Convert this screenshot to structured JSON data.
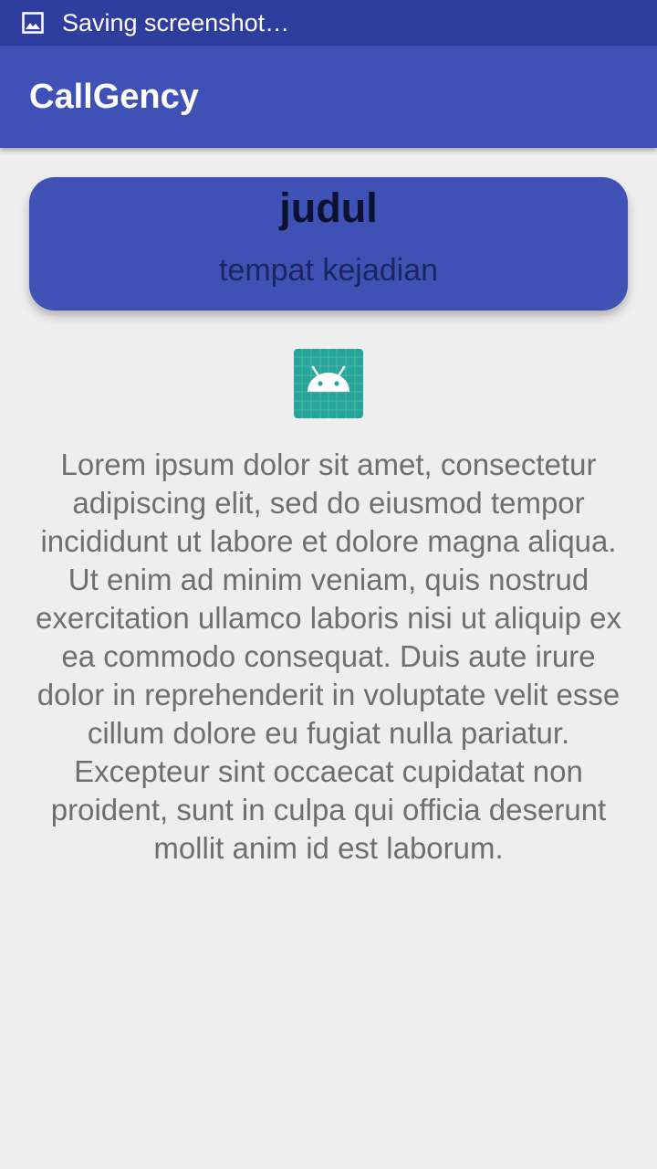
{
  "status_bar": {
    "notification_text": "Saving screenshot…",
    "icon": "image-icon"
  },
  "app_bar": {
    "title": "CallGency"
  },
  "card": {
    "title": "judul",
    "subtitle": "tempat kejadian"
  },
  "image": {
    "icon": "android-placeholder-icon"
  },
  "content": {
    "description": "Lorem ipsum dolor sit amet, consectetur adipiscing elit, sed do eiusmod tempor incididunt ut labore et dolore magna aliqua. Ut enim ad minim veniam, quis nostrud exercitation ullamco laboris nisi ut aliquip ex ea commodo consequat. Duis aute irure dolor in reprehenderit in voluptate velit esse cillum dolore eu fugiat nulla pariatur. Excepteur sint occaecat cupidatat non proident, sunt in culpa qui officia deserunt mollit anim id est laborum."
  },
  "colors": {
    "status_bar": "#2f3e9e",
    "primary": "#3f51b5",
    "background": "#eeeeee",
    "body_text": "#6f6f6f",
    "android_icon_bg": "#26a69a"
  }
}
